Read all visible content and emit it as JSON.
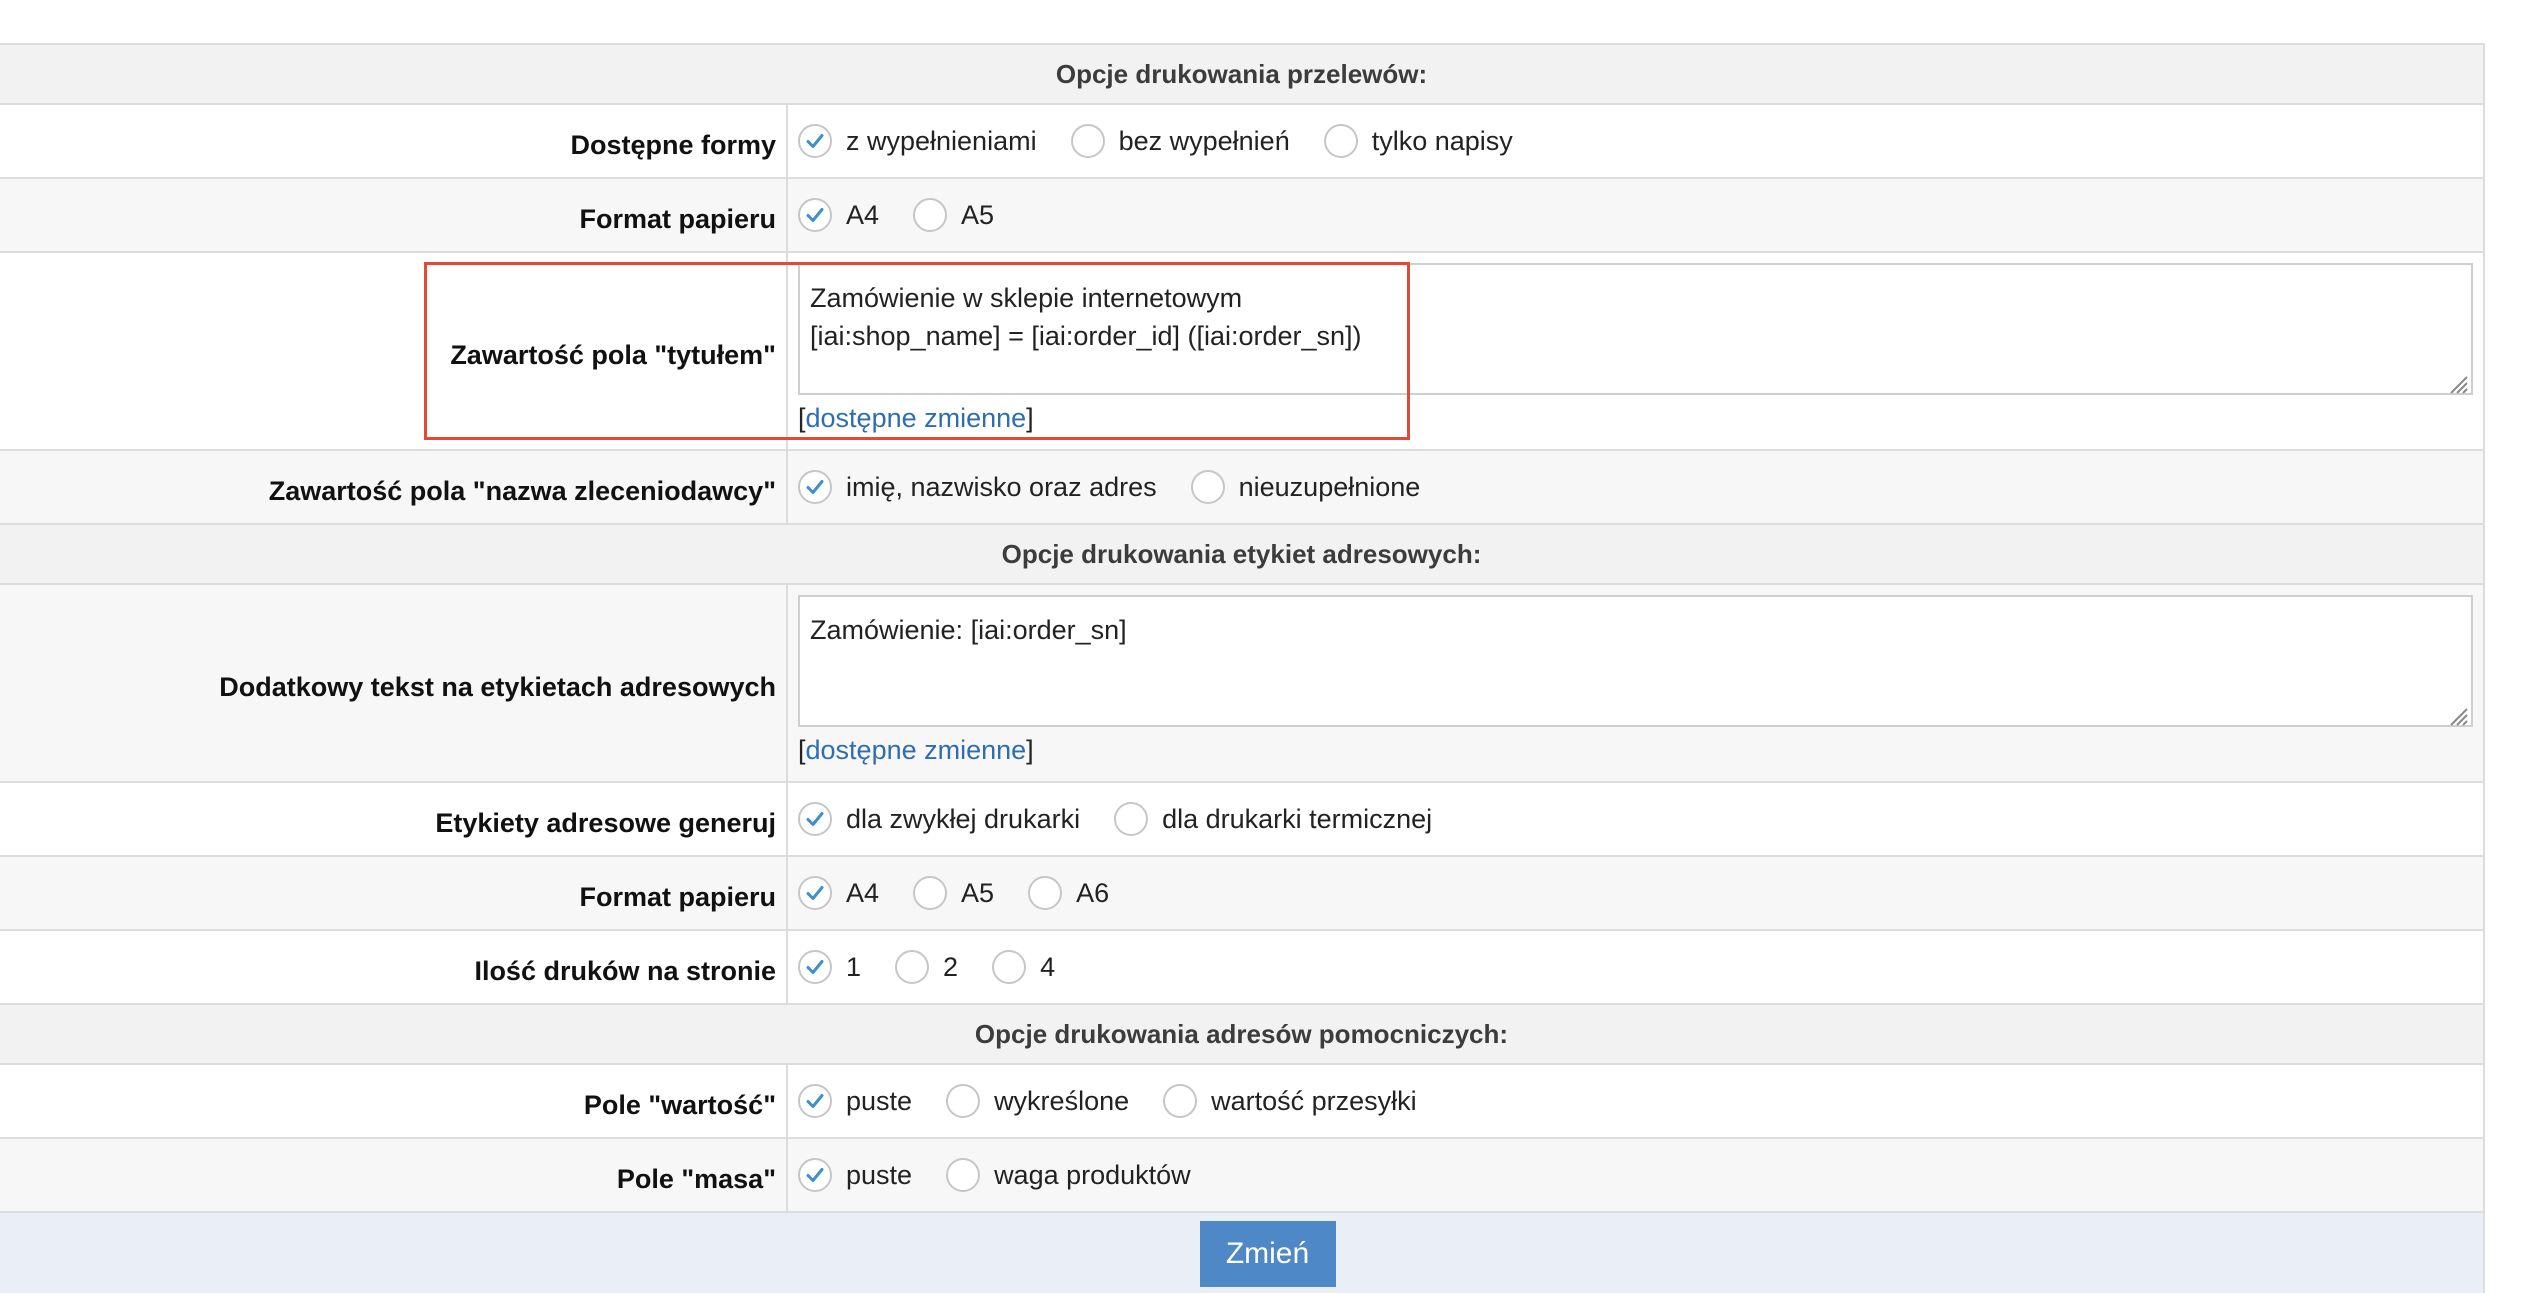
{
  "sections": {
    "transfers": {
      "title": "Opcje drukowania przelewów:"
    },
    "address_labels": {
      "title": "Opcje drukowania etykiet adresowych:"
    },
    "helper_addresses": {
      "title": "Opcje drukowania adresów pomocniczych:"
    }
  },
  "rows": {
    "available_forms": {
      "label": "Dostępne formy",
      "options": [
        "z wypełnieniami",
        "bez wypełnień",
        "tylko napisy"
      ],
      "selected": 0
    },
    "transfer_paper_format": {
      "label": "Format papieru",
      "options": [
        "A4",
        "A5"
      ],
      "selected": 0
    },
    "title_field": {
      "label": "Zawartość pola \"tytułem\"",
      "value": "Zamówienie w sklepie internetowym\n[iai:shop_name] = [iai:order_id] ([iai:order_sn])",
      "vars_open": "[",
      "vars_link": "dostępne zmienne",
      "vars_close": "]"
    },
    "payer_name": {
      "label": "Zawartość pola \"nazwa zleceniodawcy\"",
      "options": [
        "imię, nazwisko oraz adres",
        "nieuzupełnione"
      ],
      "selected": 0
    },
    "label_extra_text": {
      "label": "Dodatkowy tekst na etykietach adresowych",
      "value": "Zamówienie: [iai:order_sn]",
      "vars_open": "[",
      "vars_link": "dostępne zmienne",
      "vars_close": "]"
    },
    "labels_generate": {
      "label": "Etykiety adresowe generuj",
      "options": [
        "dla zwykłej drukarki",
        "dla drukarki termicznej"
      ],
      "selected": 0
    },
    "label_paper_format": {
      "label": "Format papieru",
      "options": [
        "A4",
        "A5",
        "A6"
      ],
      "selected": 0
    },
    "prints_per_page": {
      "label": "Ilość druków na stronie",
      "options": [
        "1",
        "2",
        "4"
      ],
      "selected": 0
    },
    "value_field": {
      "label": "Pole \"wartość\"",
      "options": [
        "puste",
        "wykreślone",
        "wartość przesyłki"
      ],
      "selected": 0
    },
    "mass_field": {
      "label": "Pole \"masa\"",
      "options": [
        "puste",
        "waga produktów"
      ],
      "selected": 0
    }
  },
  "submit": {
    "label": "Zmień"
  },
  "colors": {
    "accent": "#4f88c6",
    "check": "#3d8fd1",
    "link": "#2f6db2",
    "highlight": "#e24a33"
  }
}
